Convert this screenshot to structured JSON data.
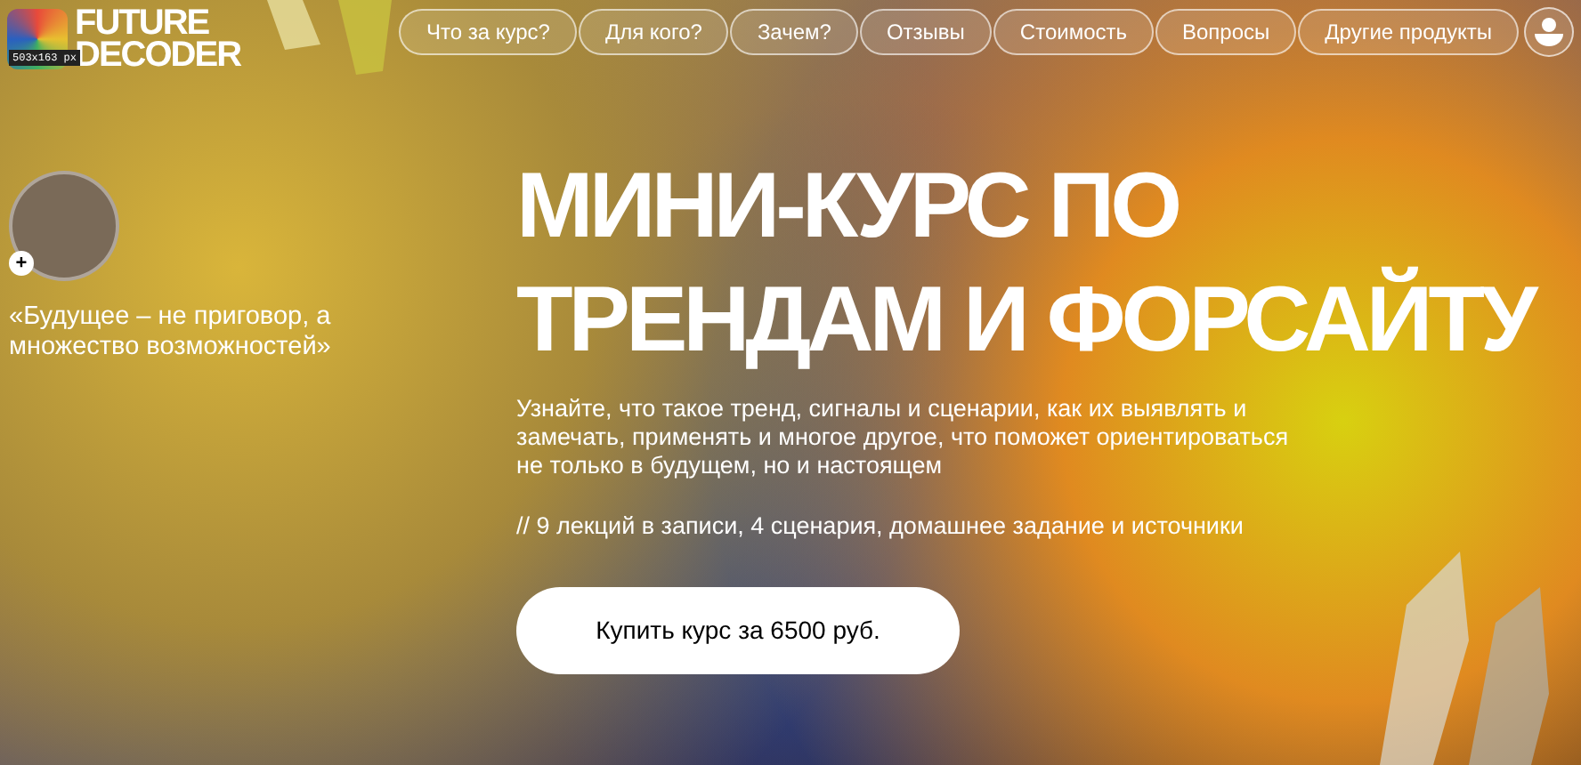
{
  "logo": {
    "line_1": "FUTURE",
    "line_2": "DECODER"
  },
  "size_tooltip": "503x163 px",
  "nav": [
    {
      "label": "Что за курс?"
    },
    {
      "label": "Для кого?"
    },
    {
      "label": "Зачем?"
    },
    {
      "label": "Отзывы"
    },
    {
      "label": "Стоимость"
    },
    {
      "label": "Вопросы"
    },
    {
      "label": "Другие продукты"
    }
  ],
  "author": {
    "quote": "«Будущее – не приговор, а множество возможностей»",
    "plus": "+"
  },
  "hero": {
    "title": "МИНИ-КУРС ПО ТРЕНДАМ И ФОРСАЙТУ",
    "description": "Узнайте, что такое тренд, сигналы и сценарии, как их выявлять и замечать, применять и многое другое, что поможет ориентироваться не только в будущем, но и настоящем",
    "includes": "// 9 лекций в записи, 4 сценария, домашнее задание и источники",
    "cta": "Купить курс за 6500 руб."
  }
}
